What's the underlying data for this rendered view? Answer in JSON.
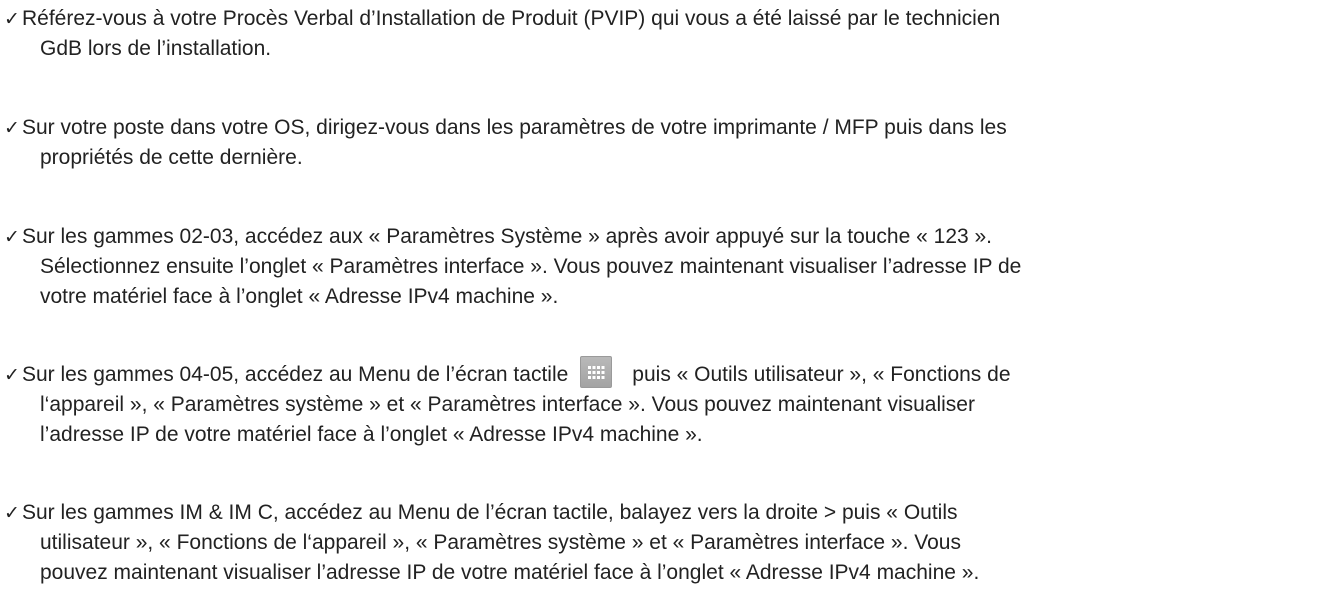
{
  "checklist": {
    "check_symbol": "✓",
    "items": [
      {
        "line1": "Référez-vous à votre Procès Verbal d’Installation de Produit (PVIP) qui vous a été laissé par le technicien",
        "line2": "GdB lors de l’installation."
      },
      {
        "line1": "Sur votre poste dans votre OS, dirigez-vous dans les paramètres de votre imprimante / MFP puis dans les",
        "line2": "propriétés de cette dernière."
      },
      {
        "line1": "Sur les gammes 02-03, accédez aux « Paramètres Système » après avoir appuyé sur la touche « 123 ».",
        "line2": "Sélectionnez ensuite l’onglet « Paramètres interface ». Vous pouvez maintenant visualiser l’adresse IP de",
        "line3": "votre matériel face à l’onglet « Adresse IPv4 machine »."
      },
      {
        "line1_before_icon": "Sur les gammes 04-05, accédez au Menu de l’écran tactile",
        "line1_icon": "touchscreen-menu-grid-icon",
        "line1_after_icon": "puis « Outils utilisateur », « Fonctions de",
        "line2": "l‘appareil », « Paramètres système » et « Paramètres interface ». Vous pouvez maintenant visualiser",
        "line3": "l’adresse IP de votre matériel face à l’onglet « Adresse IPv4 machine »."
      },
      {
        "line1": "Sur les gammes IM & IM C, accédez au Menu de l’écran tactile, balayez vers la droite > puis « Outils",
        "line2": "utilisateur », « Fonctions de l‘appareil », « Paramètres système » et « Paramètres interface ». Vous",
        "line3": "pouvez maintenant visualiser l’adresse IP de votre matériel face à l’onglet « Adresse IPv4 machine »."
      }
    ]
  }
}
